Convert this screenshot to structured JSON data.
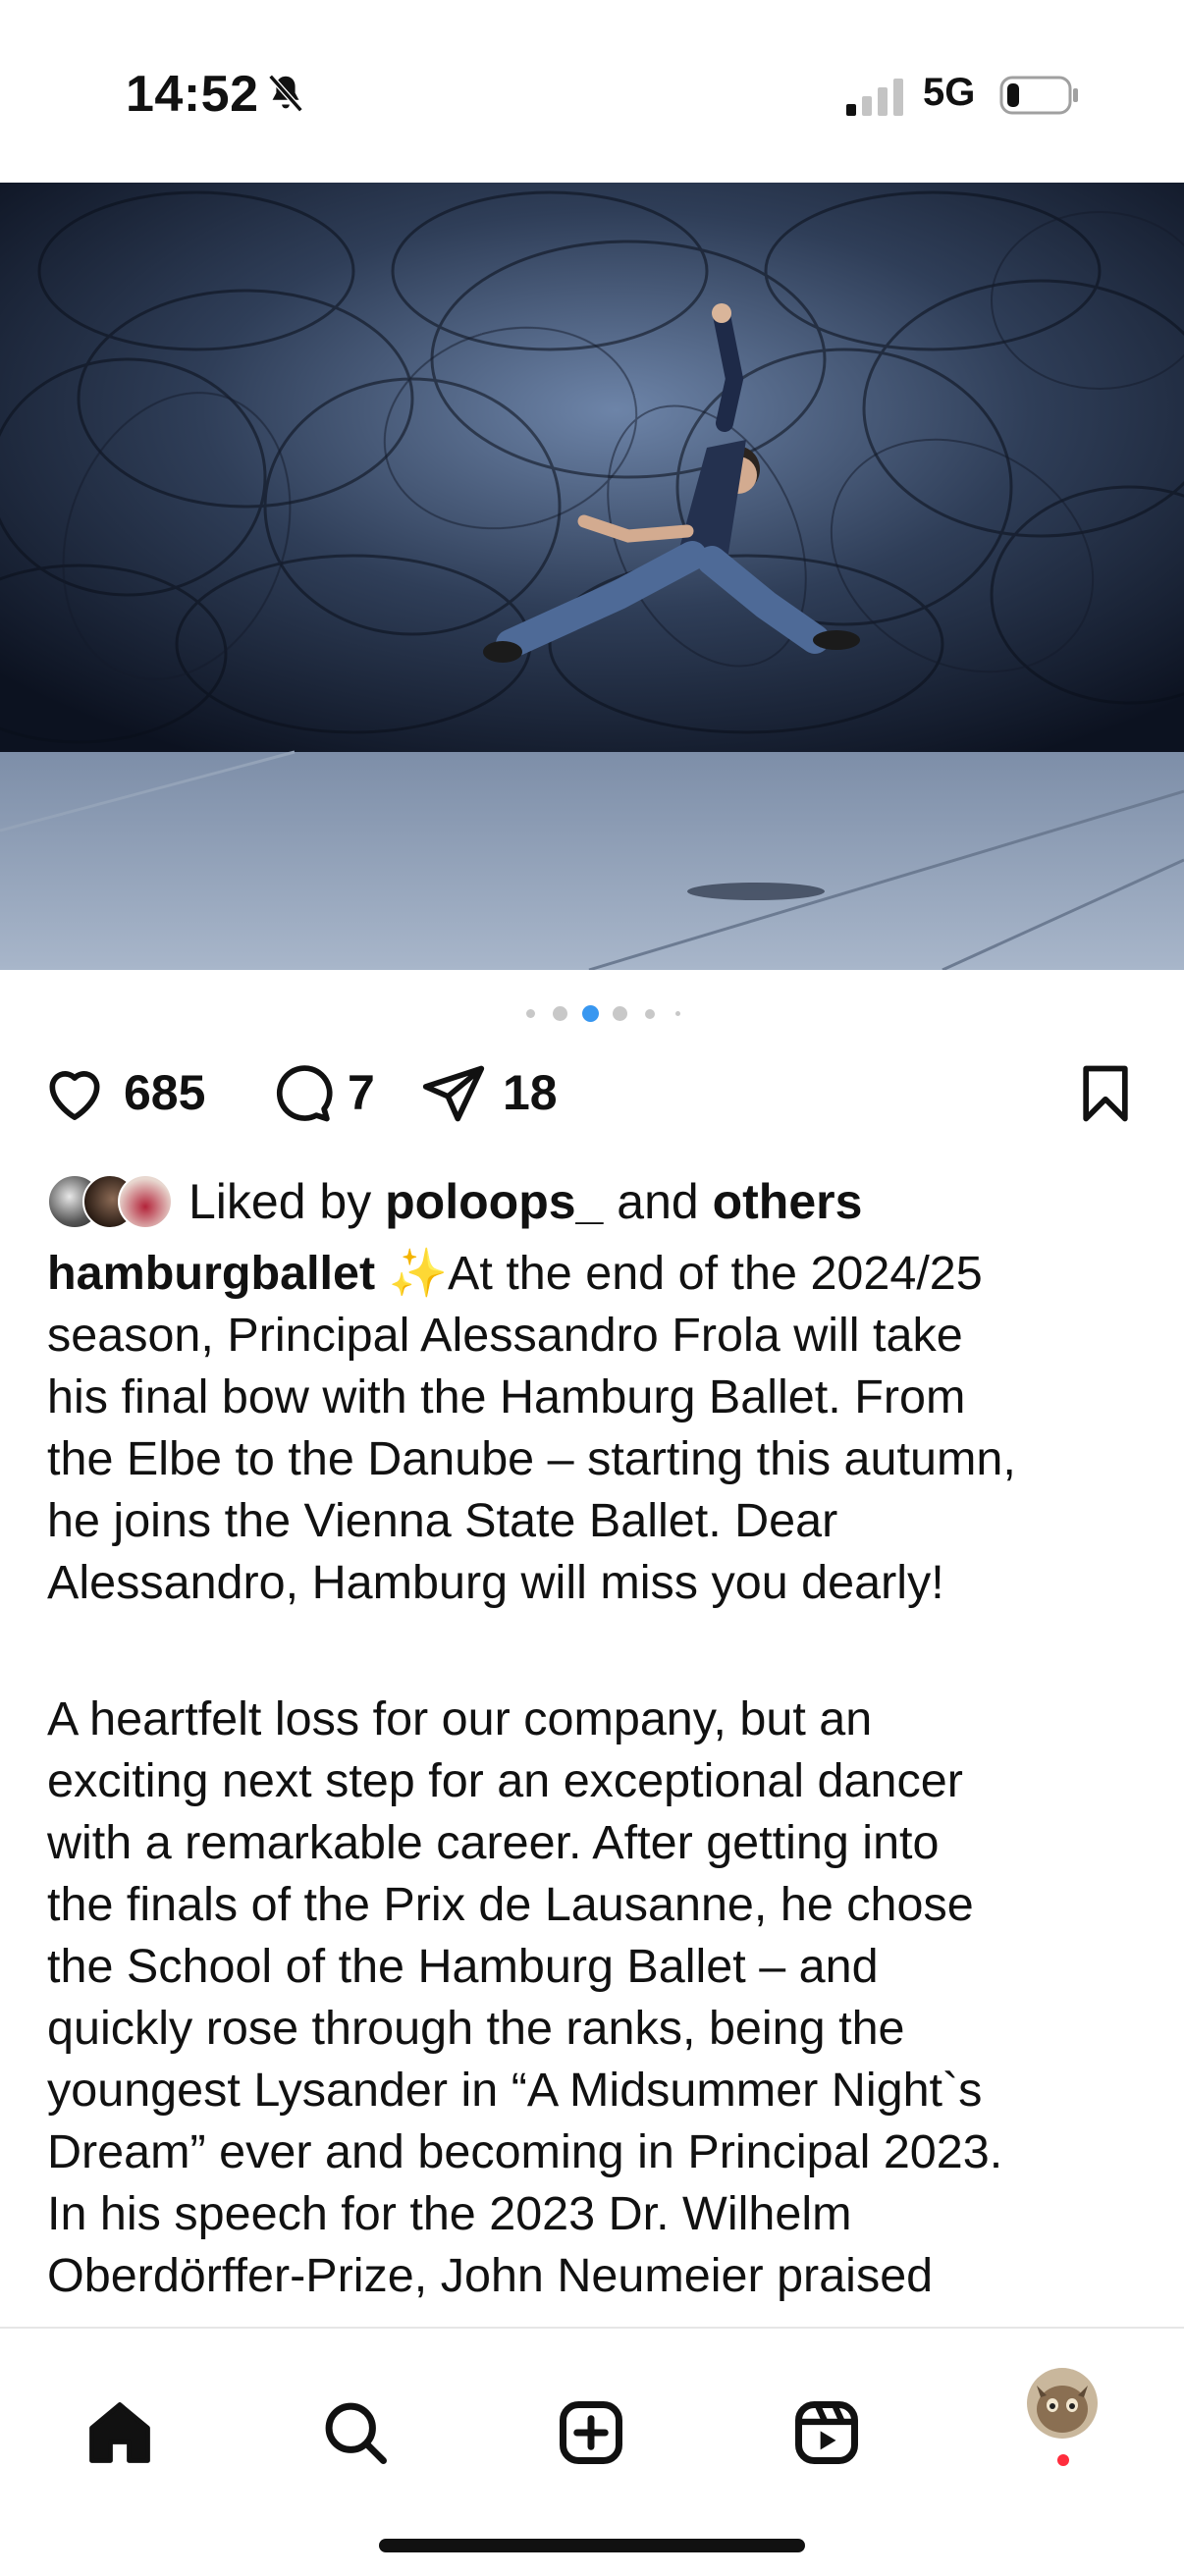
{
  "status_bar": {
    "time": "14:52",
    "network": "5G",
    "icons": [
      "bell-slash-icon",
      "signal-icon",
      "battery-icon"
    ]
  },
  "post": {
    "carousel": {
      "total_slides": 6,
      "active_slide": 3
    },
    "counts": {
      "likes": "685",
      "comments": "7",
      "shares": "18"
    },
    "liked_by": {
      "prefix": "Liked by",
      "user": "poloops_",
      "and": "and",
      "others": "others"
    },
    "caption": {
      "username": "hamburgballet",
      "emoji": "✨",
      "line1_rest": "At the end of the 2024/25",
      "lines_p1": [
        "season, Principal Alessandro Frola will take",
        "his final bow with the Hamburg Ballet. From",
        "the Elbe to the Danube – starting this autumn,",
        "he joins the Vienna State Ballet. Dear",
        "Alessandro, Hamburg will miss you dearly!"
      ],
      "lines_p2": [
        "A heartfelt loss for our company, but an",
        "exciting next step for an exceptional dancer",
        "with a remarkable career. After getting into",
        "the finals of the Prix de Lausanne, he chose",
        "the School of the Hamburg Ballet – and",
        "quickly rose through the ranks, being the",
        "youngest Lysander in “A Midsummer Night`s",
        "Dream” ever and becoming in Principal 2023.",
        "In his speech for the 2023 Dr. Wilhelm",
        "Oberdörffer-Prize, John Neumeier praised"
      ]
    }
  },
  "nav": {
    "items": [
      "home-icon",
      "search-icon",
      "create-icon",
      "reels-icon",
      "profile-avatar"
    ],
    "active": "home"
  },
  "colors": {
    "accent_dot": "#3897f0",
    "notification": "#ff2d3d"
  }
}
